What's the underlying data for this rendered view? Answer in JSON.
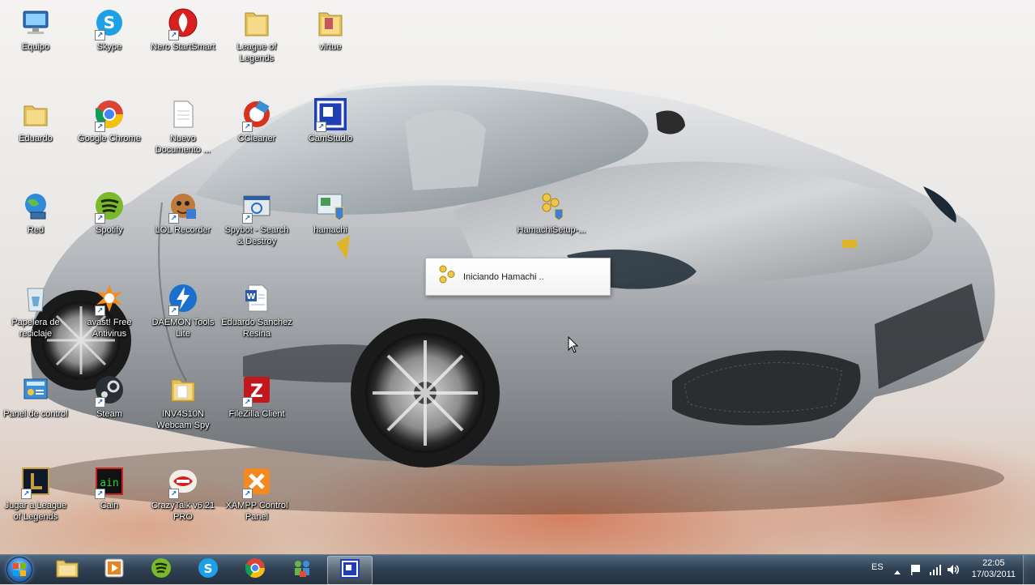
{
  "desktop": {
    "icons": [
      {
        "label": "Equipo",
        "icon": "computer-icon"
      },
      {
        "label": "Skype",
        "icon": "skype-icon"
      },
      {
        "label": "Nero StartSmart",
        "icon": "nero-icon"
      },
      {
        "label": "League of Legends",
        "icon": "folder-icon"
      },
      {
        "label": "virtue",
        "icon": "folder-icon"
      },
      {
        "label": "Eduardo",
        "icon": "user-folder-icon"
      },
      {
        "label": "Google Chrome",
        "icon": "chrome-icon"
      },
      {
        "label": "Nuevo Documento ...",
        "icon": "document-icon"
      },
      {
        "label": "CCleaner",
        "icon": "ccleaner-icon"
      },
      {
        "label": "CamStudio",
        "icon": "camstudio-icon"
      },
      {
        "label": "Red",
        "icon": "network-icon"
      },
      {
        "label": "Spotify",
        "icon": "spotify-icon"
      },
      {
        "label": "LOL Recorder",
        "icon": "lol-recorder-icon"
      },
      {
        "label": "Spybot - Search & Destroy",
        "icon": "spybot-icon"
      },
      {
        "label": "hamachi",
        "icon": "hamachi-icon"
      },
      {
        "label": "HamachiSetup-...",
        "icon": "hamachi-setup-icon"
      },
      {
        "label": "Papelera de reciclaje",
        "icon": "recycle-bin-icon"
      },
      {
        "label": "avast! Free Antivirus",
        "icon": "avast-icon"
      },
      {
        "label": "DAEMON Tools Lite",
        "icon": "daemon-tools-icon"
      },
      {
        "label": "Eduardo Sanchez Resina",
        "icon": "word-document-icon"
      },
      {
        "label": "Panel de control",
        "icon": "control-panel-icon"
      },
      {
        "label": "Steam",
        "icon": "steam-icon"
      },
      {
        "label": "INV4S10N Webcam Spy",
        "icon": "folder-icon"
      },
      {
        "label": "FileZilla Client",
        "icon": "filezilla-icon"
      },
      {
        "label": "Jugar a League of Legends",
        "icon": "league-of-legends-icon"
      },
      {
        "label": "Cain",
        "icon": "cain-icon"
      },
      {
        "label": "CrazyTalk v6.21 PRO",
        "icon": "crazytalk-icon"
      },
      {
        "label": "XAMPP Control Panel",
        "icon": "xampp-icon"
      }
    ]
  },
  "popup": {
    "message": "Iniciando Hamachi .."
  },
  "taskbar": {
    "pinned": [
      {
        "name": "explorer",
        "icon": "folder-icon"
      },
      {
        "name": "media-player",
        "icon": "media-player-icon"
      },
      {
        "name": "spotify",
        "icon": "spotify-icon"
      },
      {
        "name": "skype",
        "icon": "skype-icon"
      },
      {
        "name": "chrome",
        "icon": "chrome-icon"
      },
      {
        "name": "network-app",
        "icon": "people-icon"
      },
      {
        "name": "camstudio",
        "icon": "camstudio-icon"
      }
    ],
    "tray": {
      "language": "ES",
      "time": "22:05",
      "date": "17/03/2011"
    }
  },
  "colors": {
    "taskbar": "#2c4058",
    "wallpaper_bg": "#ecebea",
    "car_silver": "#b9bcc0",
    "accent_flame": "#c8461c"
  }
}
